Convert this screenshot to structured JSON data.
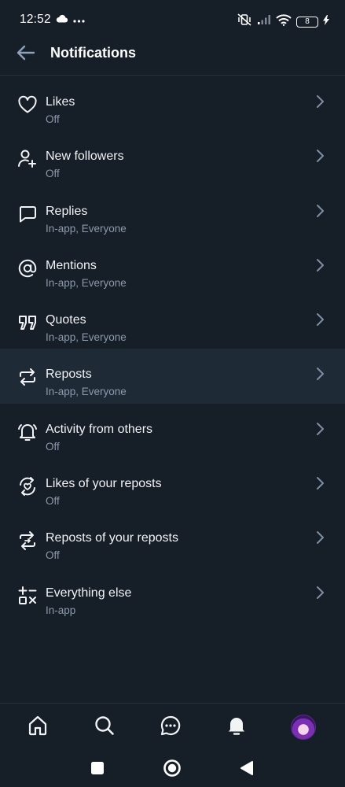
{
  "status_bar": {
    "time": "12:52",
    "battery": "8",
    "icons": [
      "cloud-icon",
      "more-dots-icon",
      "mute-vibrate-icon",
      "signal-icon",
      "wifi-icon",
      "battery-icon",
      "charging-icon"
    ]
  },
  "header": {
    "title": "Notifications",
    "back_icon": "arrow-left-icon"
  },
  "settings": [
    {
      "icon": "heart-icon",
      "title": "Likes",
      "subtitle": "Off"
    },
    {
      "icon": "person-add-icon",
      "title": "New followers",
      "subtitle": "Off"
    },
    {
      "icon": "speech-bubble-icon",
      "title": "Replies",
      "subtitle": "In-app, Everyone"
    },
    {
      "icon": "at-sign-icon",
      "title": "Mentions",
      "subtitle": "In-app, Everyone"
    },
    {
      "icon": "quote-icon",
      "title": "Quotes",
      "subtitle": "In-app, Everyone"
    },
    {
      "icon": "repost-icon",
      "title": "Reposts",
      "subtitle": "In-app, Everyone"
    },
    {
      "icon": "bell-ringing-icon",
      "title": "Activity from others",
      "subtitle": "Off"
    },
    {
      "icon": "heart-repost-icon",
      "title": "Likes of your reposts",
      "subtitle": "Off"
    },
    {
      "icon": "repost-repost-icon",
      "title": "Reposts of your reposts",
      "subtitle": "Off"
    },
    {
      "icon": "shapes-icon",
      "title": "Everything else",
      "subtitle": "In-app"
    }
  ],
  "active_row": "Reposts",
  "tab_bar": [
    "home-icon",
    "search-icon",
    "chat-icon",
    "bell-icon",
    "avatar"
  ],
  "active_tab": "bell-icon",
  "colors": {
    "background": "#161e27",
    "active_row": "#1e2a36",
    "subtitle": "#8c9aab",
    "chevron": "#7f8fa3",
    "divider": "#26313d"
  }
}
